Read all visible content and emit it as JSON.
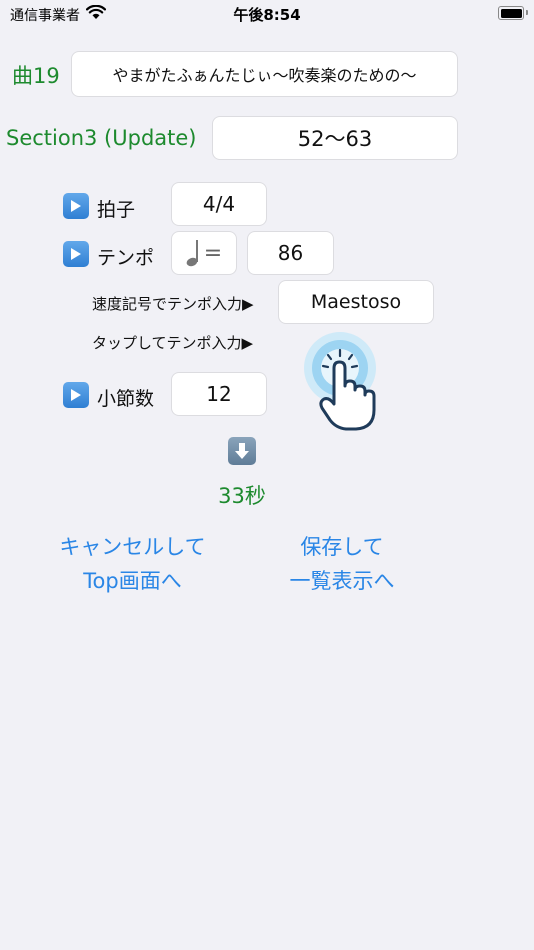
{
  "status_bar": {
    "carrier": "通信事業者",
    "time": "午後8:54"
  },
  "song": {
    "label": "曲19",
    "title": "やまがたふぁんたじぃ〜吹奏楽のための〜"
  },
  "section": {
    "label": "Section3 (Update)",
    "range": "52〜63"
  },
  "meter": {
    "label": "拍子",
    "value": "4/4"
  },
  "tempo": {
    "label": "テンポ",
    "note_symbol": "=",
    "value": "86"
  },
  "tempo_marking": {
    "label": "速度記号でテンポ入力▶",
    "value": "Maestoso"
  },
  "tap_tempo": {
    "label": "タップしてテンポ入力▶"
  },
  "measures": {
    "label": "小節数",
    "value": "12"
  },
  "duration": {
    "value": "33秒"
  },
  "actions": {
    "cancel_line1": "キャンセルして",
    "cancel_line2": "Top画面へ",
    "save_line1": "保存して",
    "save_line2": "一覧表示へ"
  },
  "colors": {
    "accent_green": "#1d8a2e",
    "link_blue": "#2a86e6",
    "background": "#f1f1f6"
  }
}
